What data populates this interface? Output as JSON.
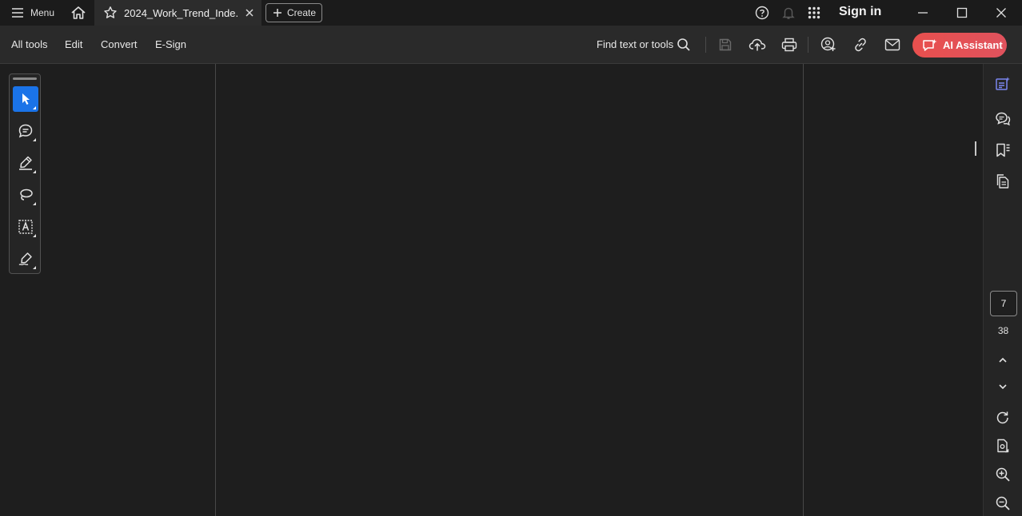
{
  "titlebar": {
    "menu_label": "Menu",
    "tab_title": "2024_Work_Trend_Inde...",
    "create_label": "Create",
    "signin_label": "Sign in"
  },
  "toolbar": {
    "items": [
      "All tools",
      "Edit",
      "Convert",
      "E-Sign"
    ],
    "find_label": "Find text or tools",
    "ai_label": "AI Assistant"
  },
  "pagination": {
    "current_page": "7",
    "total_pages": "38"
  },
  "colors": {
    "accent": "#1a73e8",
    "ai_button": "#e8504e",
    "background": "#1e1e1e",
    "rail_active": "#7b86f0"
  },
  "icons": {
    "titlebar": [
      "hamburger-icon",
      "home-icon",
      "star-icon",
      "close-icon",
      "plus-icon",
      "help-icon",
      "bell-icon",
      "apps-grid-icon",
      "minimize-icon",
      "maximize-icon",
      "window-close-icon"
    ],
    "toolbar": [
      "search-icon",
      "save-icon",
      "upload-icon",
      "print-icon",
      "share-user-icon",
      "link-icon",
      "mail-icon",
      "ai-sparkle-icon"
    ],
    "palette": [
      "cursor-icon",
      "comment-icon",
      "highlight-pen-icon",
      "lasso-icon",
      "text-select-icon",
      "sign-pen-icon"
    ],
    "right_rail": [
      "edit-panel-icon",
      "comments-panel-icon",
      "bookmarks-icon",
      "pages-icon",
      "chevron-up-icon",
      "chevron-down-icon",
      "refresh-icon",
      "page-settings-icon",
      "zoom-in-icon",
      "zoom-out-icon"
    ]
  }
}
